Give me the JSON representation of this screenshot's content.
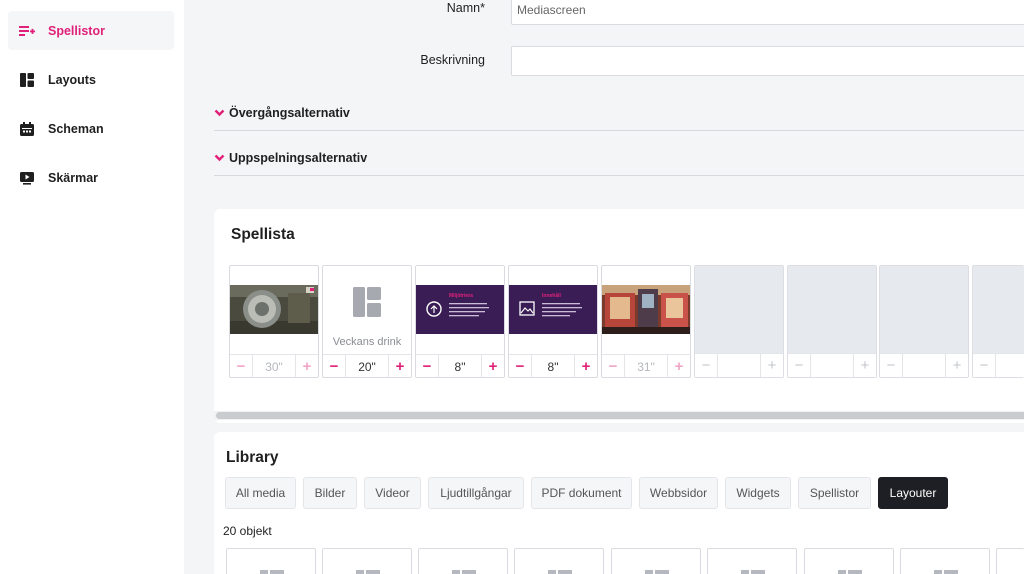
{
  "sidebar": {
    "items": [
      {
        "label": "Spellistor",
        "icon": "playlist-add-icon",
        "active": true
      },
      {
        "label": "Layouts",
        "icon": "layout-icon",
        "active": false
      },
      {
        "label": "Scheman",
        "icon": "calendar-icon",
        "active": false
      },
      {
        "label": "Skärmar",
        "icon": "screen-play-icon",
        "active": false
      }
    ]
  },
  "form": {
    "name_label": "Namn*",
    "name_value": "Mediascreen",
    "description_label": "Beskrivning",
    "description_value": ""
  },
  "accordions": [
    {
      "label": "Övergångsalternativ"
    },
    {
      "label": "Uppspelningsalternativ"
    }
  ],
  "playlist": {
    "title": "Spellista",
    "items": [
      {
        "type": "image",
        "duration": "30\"",
        "dim": true
      },
      {
        "type": "layout",
        "caption": "Veckans drink",
        "duration": "20\""
      },
      {
        "type": "slide",
        "slide_title": "Miljötriera",
        "duration": "8\""
      },
      {
        "type": "slide",
        "slide_title": "Innehåll",
        "duration": "8\""
      },
      {
        "type": "image",
        "duration": "31\"",
        "dim": true
      }
    ],
    "empty_slots": 4
  },
  "library": {
    "title": "Library",
    "filters": [
      "All media",
      "Bilder",
      "Videor",
      "Ljudtillgångar",
      "PDF dokument",
      "Webbsidor",
      "Widgets",
      "Spellistor",
      "Layouter"
    ],
    "active_filter": "Layouter",
    "count_text": "20 objekt"
  },
  "colors": {
    "accent": "#e0217a",
    "slide_bg": "#3a1d55",
    "active_filter_bg": "#1e1f24"
  }
}
